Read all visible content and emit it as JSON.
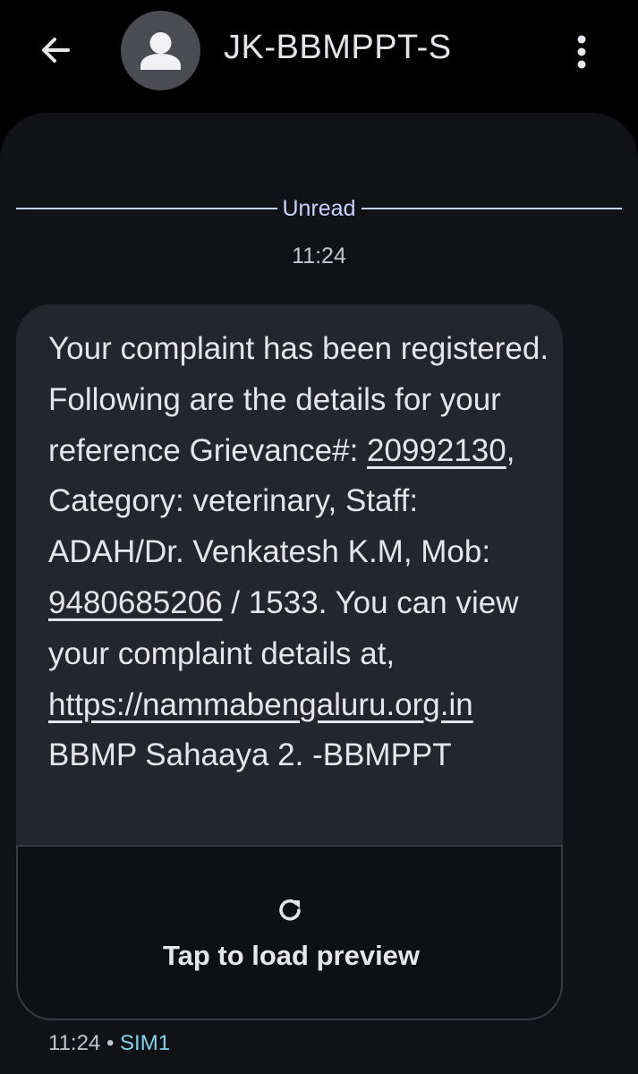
{
  "header": {
    "contact_name": "JK-BBMPPT-S",
    "back_icon": "arrow-left-icon",
    "avatar_icon": "person-icon",
    "more_icon": "more-vert-icon"
  },
  "conversation": {
    "unread_label": "Unread",
    "timestamp": "11:24",
    "message": {
      "text_1": "Your complaint has been registered. Following are the details for your reference Grievance#: ",
      "grievance_link": "20992130",
      "text_2": ", Category: veterinary, Staff: ADAH/Dr. Venkatesh K.M, Mob: ",
      "phone_link": "9480685206",
      "text_3": " / 1533. You can view your complaint details at, ",
      "url_link": "https://nammabengaluru.org.in",
      "text_4": " BBMP Sahaaya 2. -BBMPPT"
    },
    "preview": {
      "icon": "refresh-icon",
      "label": "Tap to load preview"
    },
    "footer": {
      "time": "11:24",
      "separator": "•",
      "sim": "SIM1"
    }
  },
  "colors": {
    "background": "#000000",
    "panel": "#111216",
    "bubble": "#25262b",
    "unread_accent": "#c6d2ff",
    "sim_accent": "#7fd3f0"
  }
}
